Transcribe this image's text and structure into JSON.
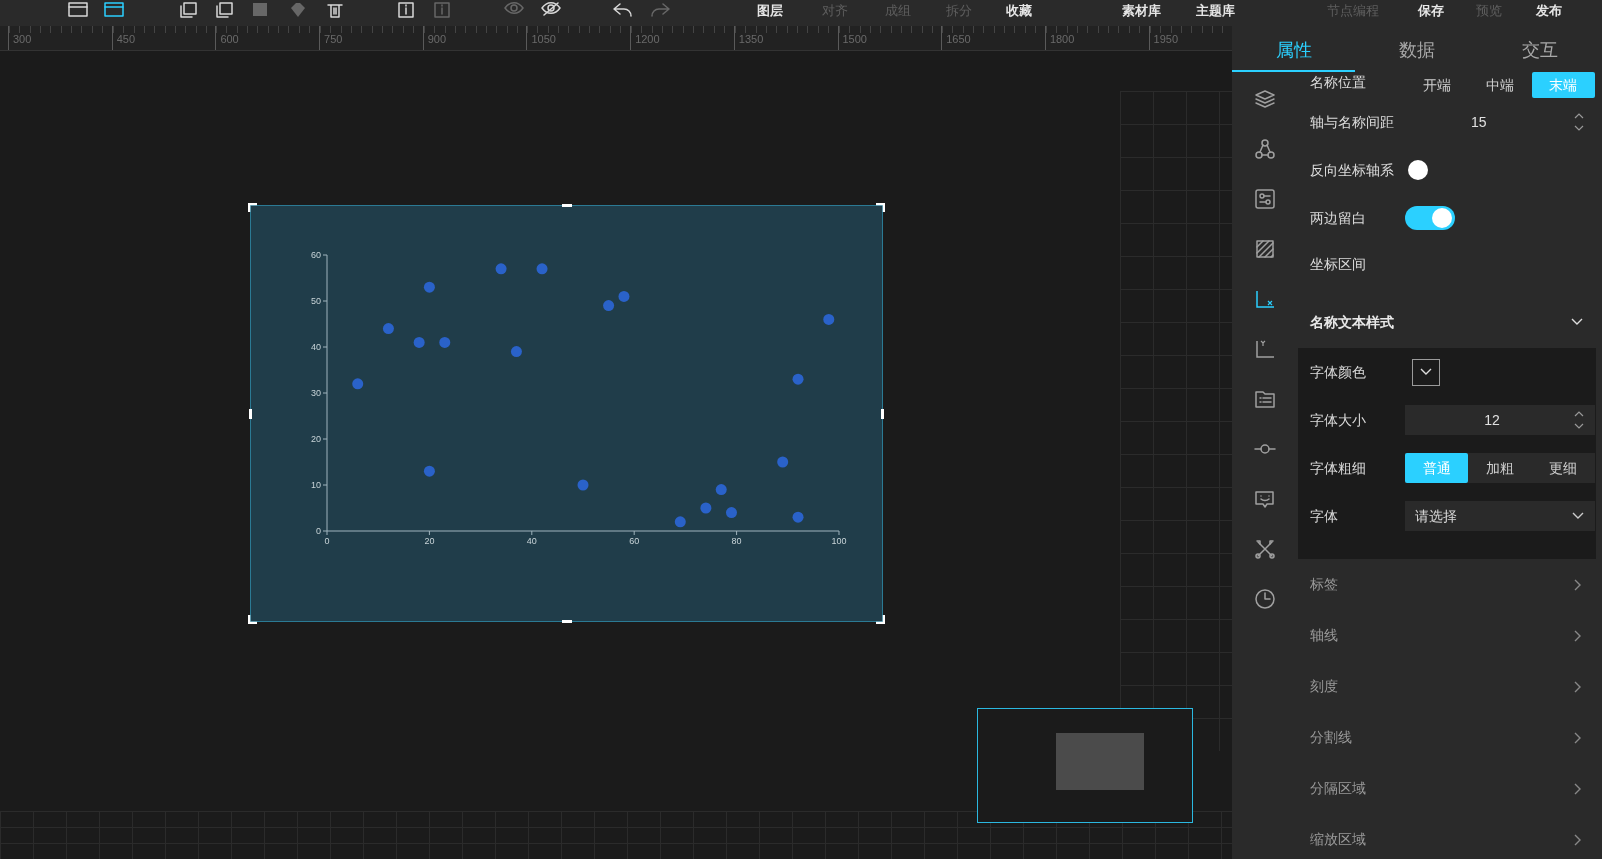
{
  "toolbar": {
    "icons": [
      {
        "kind": "frame",
        "disabled": false,
        "selected": false
      },
      {
        "kind": "frame",
        "disabled": false,
        "selected": true
      },
      {
        "kind": "copy",
        "disabled": false,
        "selected": false
      },
      {
        "kind": "copy",
        "disabled": false,
        "selected": false
      },
      {
        "kind": "block",
        "disabled": true,
        "selected": false
      },
      {
        "kind": "diamond",
        "disabled": true,
        "selected": false
      },
      {
        "kind": "trash",
        "disabled": false,
        "selected": false
      },
      {
        "kind": "info",
        "disabled": false,
        "selected": false
      },
      {
        "kind": "info",
        "disabled": true,
        "selected": false
      },
      {
        "kind": "eye",
        "disabled": true,
        "selected": false
      },
      {
        "kind": "eye-off",
        "disabled": false,
        "selected": false
      },
      {
        "kind": "undo",
        "disabled": false,
        "selected": false
      },
      {
        "kind": "redo",
        "disabled": true,
        "selected": false
      }
    ],
    "edit_buttons": [
      {
        "label": "图层",
        "disabled": false
      },
      {
        "label": "对齐",
        "disabled": true
      },
      {
        "label": "成组",
        "disabled": true
      },
      {
        "label": "拆分",
        "disabled": true
      },
      {
        "label": "收藏",
        "disabled": false
      }
    ],
    "library_buttons": [
      {
        "label": "素材库",
        "disabled": false
      },
      {
        "label": "主题库",
        "disabled": false
      }
    ],
    "publish_buttons": [
      {
        "label": "节点编程",
        "disabled": true
      },
      {
        "label": "保存",
        "disabled": false
      },
      {
        "label": "预览",
        "disabled": true
      },
      {
        "label": "发布",
        "disabled": false
      }
    ]
  },
  "ruler": {
    "labels": [
      "300",
      "450",
      "600",
      "750",
      "900",
      "1050",
      "1200",
      "1350",
      "1500",
      "1650",
      "1800",
      "1950"
    ]
  },
  "chart": {
    "chart_data": {
      "type": "scatter",
      "x": [
        6,
        12,
        18,
        20,
        23,
        20,
        34,
        37,
        42,
        50,
        55,
        58,
        69,
        74,
        77,
        79,
        89,
        92,
        92,
        98
      ],
      "series": [
        {
          "color": "#2a62c9",
          "values": [
            32,
            44,
            41,
            53,
            41,
            13,
            57,
            39,
            57,
            10,
            49,
            51,
            2,
            5,
            9,
            4,
            15,
            33,
            3,
            46
          ]
        }
      ],
      "xlim": [
        0,
        100
      ],
      "ylim": [
        0,
        60
      ],
      "xticks": [
        0,
        20,
        40,
        60,
        80,
        100
      ],
      "yticks": [
        0,
        10,
        20,
        30,
        40,
        50,
        60
      ]
    }
  },
  "panel": {
    "tabs": [
      {
        "label": "属性",
        "selected": true
      },
      {
        "label": "数据",
        "selected": false
      },
      {
        "label": "交互",
        "selected": false
      }
    ],
    "nav_icons": [
      {
        "kind": "layers",
        "selected": false
      },
      {
        "kind": "nodes",
        "selected": false
      },
      {
        "kind": "sliders",
        "selected": false
      },
      {
        "kind": "hatch",
        "selected": false
      },
      {
        "kind": "x-axis",
        "selected": true
      },
      {
        "kind": "y-axis",
        "selected": false
      },
      {
        "kind": "list",
        "selected": false
      },
      {
        "kind": "connector",
        "selected": false
      },
      {
        "kind": "chat",
        "selected": false
      },
      {
        "kind": "tools",
        "selected": false
      },
      {
        "kind": "clock",
        "selected": false
      }
    ],
    "rows": [
      {
        "kind": "segmented",
        "label": "名称位置",
        "options": [
          {
            "label": "开端",
            "selected": false
          },
          {
            "label": "中端",
            "selected": false
          },
          {
            "label": "末端",
            "selected": true
          }
        ]
      },
      {
        "kind": "number",
        "label": "轴与名称间距",
        "value": "15"
      },
      {
        "kind": "toggle",
        "label": "反向坐标轴系",
        "on": false
      },
      {
        "kind": "toggle",
        "label": "两边留白",
        "on": true
      },
      {
        "kind": "plain",
        "label": "坐标区间"
      }
    ],
    "style_section": {
      "title": "名称文本样式",
      "expanded": true,
      "rows": [
        {
          "kind": "color",
          "label": "字体颜色"
        },
        {
          "kind": "number",
          "label": "字体大小",
          "value": "12"
        },
        {
          "kind": "segmented",
          "label": "字体粗细",
          "options": [
            {
              "label": "普通",
              "selected": true
            },
            {
              "label": "加粗",
              "selected": false
            },
            {
              "label": "更细",
              "selected": false
            }
          ]
        },
        {
          "kind": "select",
          "label": "字体",
          "placeholder": "请选择"
        }
      ]
    },
    "sections": [
      {
        "title": "标签"
      },
      {
        "title": "轴线"
      },
      {
        "title": "刻度"
      },
      {
        "title": "分割线"
      },
      {
        "title": "分隔区域"
      },
      {
        "title": "缩放区域"
      }
    ]
  }
}
